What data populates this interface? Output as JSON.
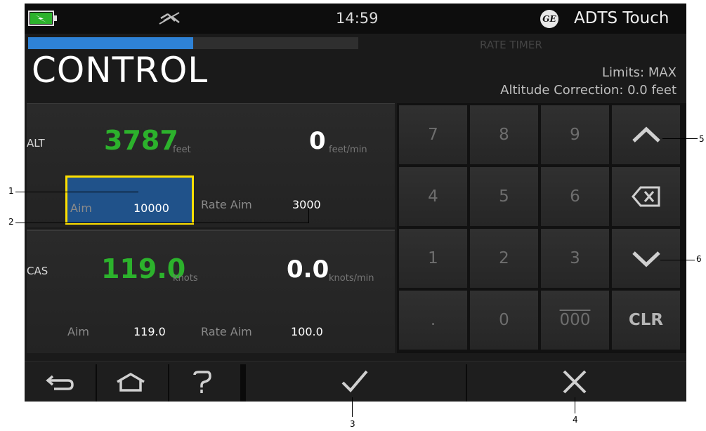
{
  "status_bar": {
    "time": "14:59",
    "product_name": "ADTS Touch",
    "logo_text": "GE",
    "icons": [
      "battery-charging-icon",
      "usb-disconnected-icon",
      "ge-logo"
    ]
  },
  "header": {
    "title": "CONTROL",
    "rate_timer_label": "RATE TIMER",
    "limits": "Limits: MAX",
    "altitude_correction": "Altitude Correction: 0.0 feet",
    "progress_fraction": 0.5
  },
  "alt": {
    "label": "ALT",
    "value": "3787",
    "unit": "feet",
    "rate_value": "0",
    "rate_unit": "feet/min",
    "aim_label": "Aim",
    "aim_value": "10000",
    "rate_aim_label": "Rate Aim",
    "rate_aim_value": "3000"
  },
  "cas": {
    "label": "CAS",
    "value": "119.0",
    "unit": "knots",
    "rate_value": "0.0",
    "rate_unit": "knots/min",
    "aim_label": "Aim",
    "aim_value": "119.0",
    "rate_aim_label": "Rate Aim",
    "rate_aim_value": "100.0"
  },
  "keypad": {
    "k7": "7",
    "k8": "8",
    "k9": "9",
    "k4": "4",
    "k5": "5",
    "k6": "6",
    "k1": "1",
    "k2": "2",
    "k3": "3",
    "kdot": ".",
    "k0": "0",
    "k000": "000",
    "clr": "CLR",
    "icons": [
      "chevron-up-icon",
      "backspace-icon",
      "chevron-down-icon"
    ]
  },
  "navbar": {
    "icons": [
      "back-icon",
      "home-icon",
      "help-icon",
      "check-icon",
      "close-icon"
    ]
  },
  "callouts": {
    "c1": "1",
    "c2": "2",
    "c3": "3",
    "c4": "4",
    "c5": "5",
    "c6": "6"
  }
}
